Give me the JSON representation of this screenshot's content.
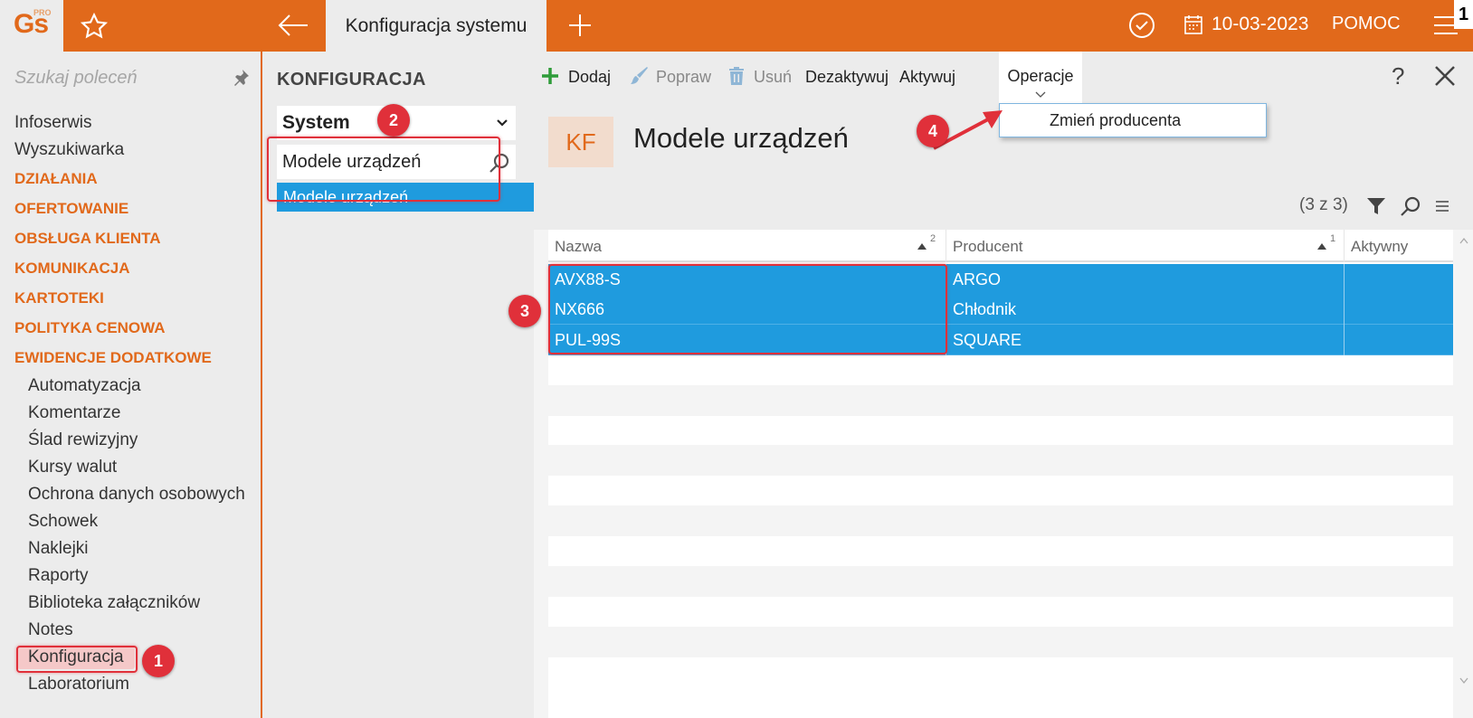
{
  "topbar": {
    "logo_text": "Gs",
    "logo_sup": "PRO",
    "active_tab": "Konfiguracja systemu",
    "date": "10-03-2023",
    "help": "POMOC",
    "corner_badge": "1",
    "accent": "#e1691b"
  },
  "sidebar": {
    "search_placeholder": "Szukaj poleceń",
    "items": [
      {
        "label": "Infoserwis",
        "kind": "item"
      },
      {
        "label": "Wyszukiwarka",
        "kind": "item"
      },
      {
        "label": "DZIAŁANIA",
        "kind": "category"
      },
      {
        "label": "OFERTOWANIE",
        "kind": "category"
      },
      {
        "label": "OBSŁUGA KLIENTA",
        "kind": "category"
      },
      {
        "label": "KOMUNIKACJA",
        "kind": "category"
      },
      {
        "label": "KARTOTEKI",
        "kind": "category"
      },
      {
        "label": "POLITYKA CENOWA",
        "kind": "category"
      },
      {
        "label": "EWIDENCJE DODATKOWE",
        "kind": "category"
      },
      {
        "label": "Automatyzacja",
        "kind": "sub"
      },
      {
        "label": "Komentarze",
        "kind": "sub"
      },
      {
        "label": "Ślad rewizyjny",
        "kind": "sub"
      },
      {
        "label": "Kursy walut",
        "kind": "sub"
      },
      {
        "label": "Ochrona danych osobowych",
        "kind": "sub"
      },
      {
        "label": "Schowek",
        "kind": "sub"
      },
      {
        "label": "Naklejki",
        "kind": "sub"
      },
      {
        "label": "Raporty",
        "kind": "sub"
      },
      {
        "label": "Biblioteka załączników",
        "kind": "sub"
      },
      {
        "label": "Notes",
        "kind": "sub"
      },
      {
        "label": "Konfiguracja",
        "kind": "sub-highlight"
      },
      {
        "label": "Laboratorium",
        "kind": "sub"
      }
    ]
  },
  "config": {
    "title": "KONFIGURACJA",
    "select_value": "System",
    "search_value": "Modele urządzeń",
    "result_item": "Modele urządzeń"
  },
  "toolbar": {
    "add": "Dodaj",
    "edit": "Popraw",
    "delete": "Usuń",
    "deactivate": "Dezaktywuj",
    "activate": "Aktywuj",
    "operations": "Operacje",
    "help": "?",
    "operations_menu": [
      "Zmień producenta"
    ]
  },
  "header": {
    "badge": "KF",
    "title": "Modele urządzeń",
    "count": "(3 z 3)"
  },
  "grid": {
    "columns": [
      {
        "label": "Nazwa",
        "sort_index": "2"
      },
      {
        "label": "Producent",
        "sort_index": "1"
      },
      {
        "label": "Aktywny",
        "sort_index": ""
      }
    ],
    "rows": [
      {
        "nazwa": "AVX88-S",
        "producent": "ARGO"
      },
      {
        "nazwa": "NX666",
        "producent": "Chłodnik"
      },
      {
        "nazwa": "PUL-99S",
        "producent": "SQUARE"
      }
    ],
    "selection_color": "#1f9bde"
  },
  "annotations": [
    "1",
    "2",
    "3",
    "4"
  ]
}
